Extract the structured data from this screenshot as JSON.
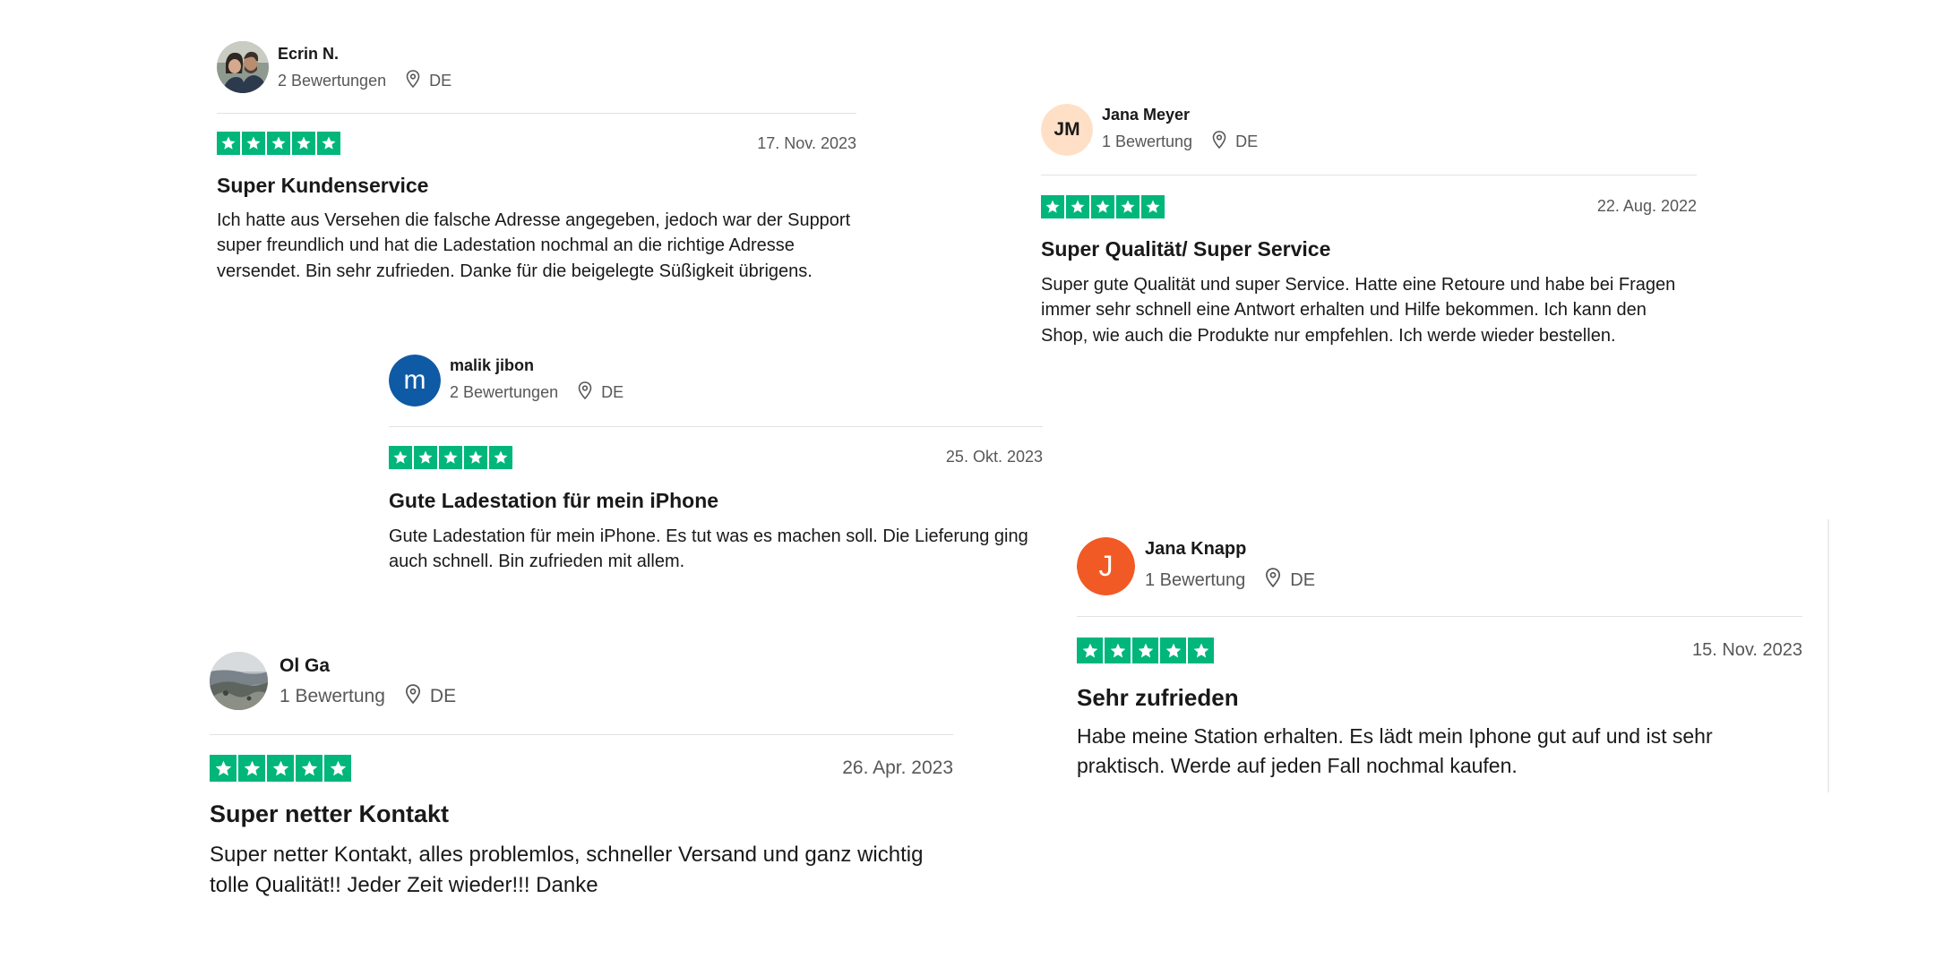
{
  "colors": {
    "star_green": "#00b67a",
    "divider": "#e2e2e2",
    "meta_gray": "#575757"
  },
  "reviews": [
    {
      "name": "Ecrin N.",
      "count": "2 Bewertungen",
      "country": "DE",
      "date": "17. Nov. 2023",
      "rating": 5,
      "title": "Super Kundenservice",
      "body": "Ich hatte aus Versehen die falsche Adresse angegeben, jedoch war der Support super freundlich und hat die Ladestation nochmal an die richtige Adresse versendet. Bin sehr zufrieden. Danke für die beigelegte Süßigkeit übrigens.",
      "avatar": {
        "type": "photo",
        "icon": "couple-photo"
      }
    },
    {
      "name": "Jana Meyer",
      "count": "1 Bewertung",
      "country": "DE",
      "date": "22. Aug. 2022",
      "rating": 5,
      "title": "Super Qualität/ Super Service",
      "body": "Super gute Qualität und super Service. Hatte eine Retoure und habe bei Fragen immer sehr schnell eine Antwort erhalten und Hilfe bekommen. Ich kann den Shop, wie auch die Produkte nur empfehlen. Ich werde wieder bestellen.",
      "avatar": {
        "type": "initials",
        "text": "JM",
        "bg": "#ffe0c7",
        "fg": "#191919"
      }
    },
    {
      "name": "malik jibon",
      "count": "2 Bewertungen",
      "country": "DE",
      "date": "25. Okt. 2023",
      "rating": 5,
      "title": "Gute Ladestation für mein iPhone",
      "body": "Gute Ladestation für mein iPhone. Es tut was es machen soll. Die Lieferung ging auch schnell. Bin zufrieden mit allem.",
      "avatar": {
        "type": "initials",
        "text": "m",
        "bg": "#0f5aa5",
        "fg": "#ffffff"
      }
    },
    {
      "name": "Jana Knapp",
      "count": "1 Bewertung",
      "country": "DE",
      "date": "15. Nov. 2023",
      "rating": 5,
      "title": "Sehr zufrieden",
      "body": "Habe meine Station erhalten. Es lädt mein Iphone gut auf und ist sehr praktisch. Werde auf jeden Fall nochmal kaufen.",
      "avatar": {
        "type": "initials",
        "text": "J",
        "bg": "#f15a24",
        "fg": "#ffffff"
      }
    },
    {
      "name": "Ol Ga",
      "count": "1 Bewertung",
      "country": "DE",
      "date": "26. Apr. 2023",
      "rating": 5,
      "title": "Super netter Kontakt",
      "body": "Super netter Kontakt, alles problemlos, schneller Versand und ganz wichtig tolle Qualität!! Jeder Zeit wieder!!! Danke",
      "avatar": {
        "type": "photo",
        "icon": "beach-photo"
      }
    }
  ]
}
